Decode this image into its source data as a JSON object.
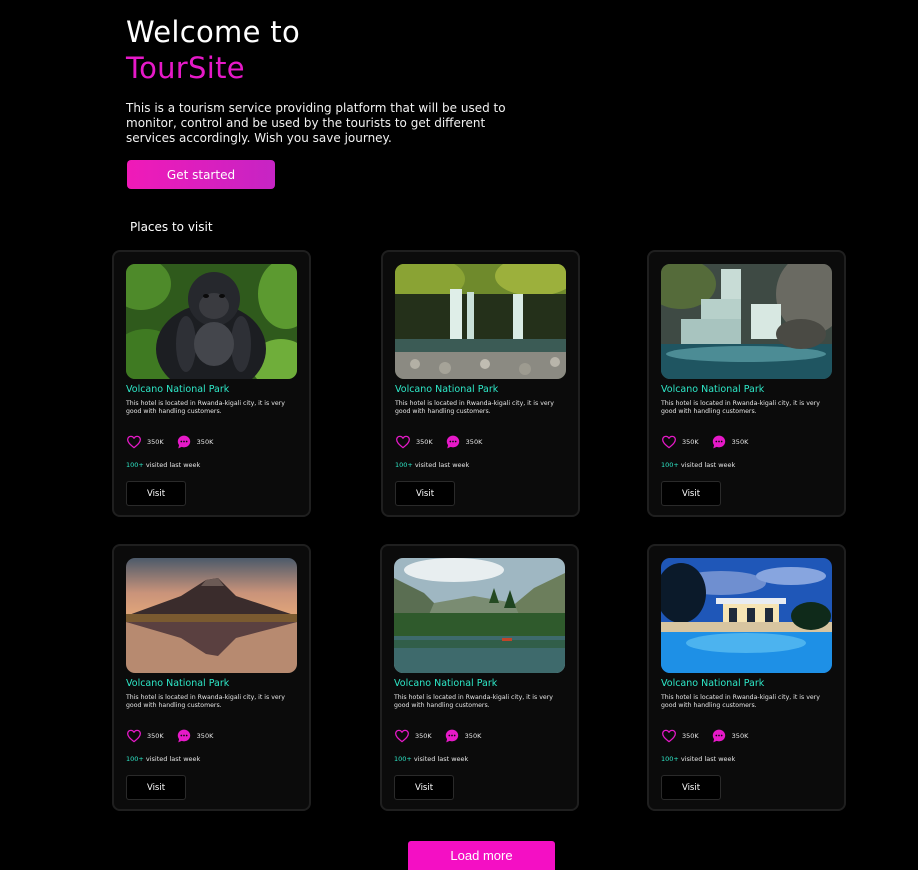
{
  "hero": {
    "title_line1": "Welcome to",
    "title_brand": "TourSite",
    "description": "This is a tourism service providing platform that will be used to monitor, control and be used by the tourists to get different services accordingly. Wish you save journey.",
    "cta_label": "Get started"
  },
  "section_title": "Places to visit",
  "colors": {
    "brand": "#e619c8",
    "accent_teal": "#2ee8c8",
    "button_pink": "#f40fc4",
    "background": "#000000"
  },
  "places": [
    {
      "image": "gorilla",
      "title": "Volcano National Park",
      "description": "This hotel is located in Rwanda-kigali city, it is very good with handling customers.",
      "likes": "350K",
      "comments": "350K",
      "visited_count": "100+",
      "visited_text": "visited last week",
      "button": "Visit"
    },
    {
      "image": "waterfall-forest",
      "title": "Volcano National Park",
      "description": "This hotel is located in Rwanda-kigali city, it is very good with handling customers.",
      "likes": "350K",
      "comments": "350K",
      "visited_count": "100+",
      "visited_text": "visited last week",
      "button": "Visit"
    },
    {
      "image": "waterfall-rocks",
      "title": "Volcano National Park",
      "description": "This hotel is located in Rwanda-kigali city, it is very good with handling customers.",
      "likes": "350K",
      "comments": "350K",
      "visited_count": "100+",
      "visited_text": "visited last week",
      "button": "Visit"
    },
    {
      "image": "volcano-mountain",
      "title": "Volcano National Park",
      "description": "This hotel is located in Rwanda-kigali city, it is very good with handling customers.",
      "likes": "350K",
      "comments": "350K",
      "visited_count": "100+",
      "visited_text": "visited last week",
      "button": "Visit"
    },
    {
      "image": "lake-valley",
      "title": "Volcano National Park",
      "description": "This hotel is located in Rwanda-kigali city, it is very good with handling customers.",
      "likes": "350K",
      "comments": "350K",
      "visited_count": "100+",
      "visited_text": "visited last week",
      "button": "Visit"
    },
    {
      "image": "resort-pool",
      "title": "Volcano National Park",
      "description": "This hotel is located in Rwanda-kigali city, it is very good with handling customers.",
      "likes": "350K",
      "comments": "350K",
      "visited_count": "100+",
      "visited_text": "visited last week",
      "button": "Visit"
    }
  ],
  "load_more_label": "Load more"
}
